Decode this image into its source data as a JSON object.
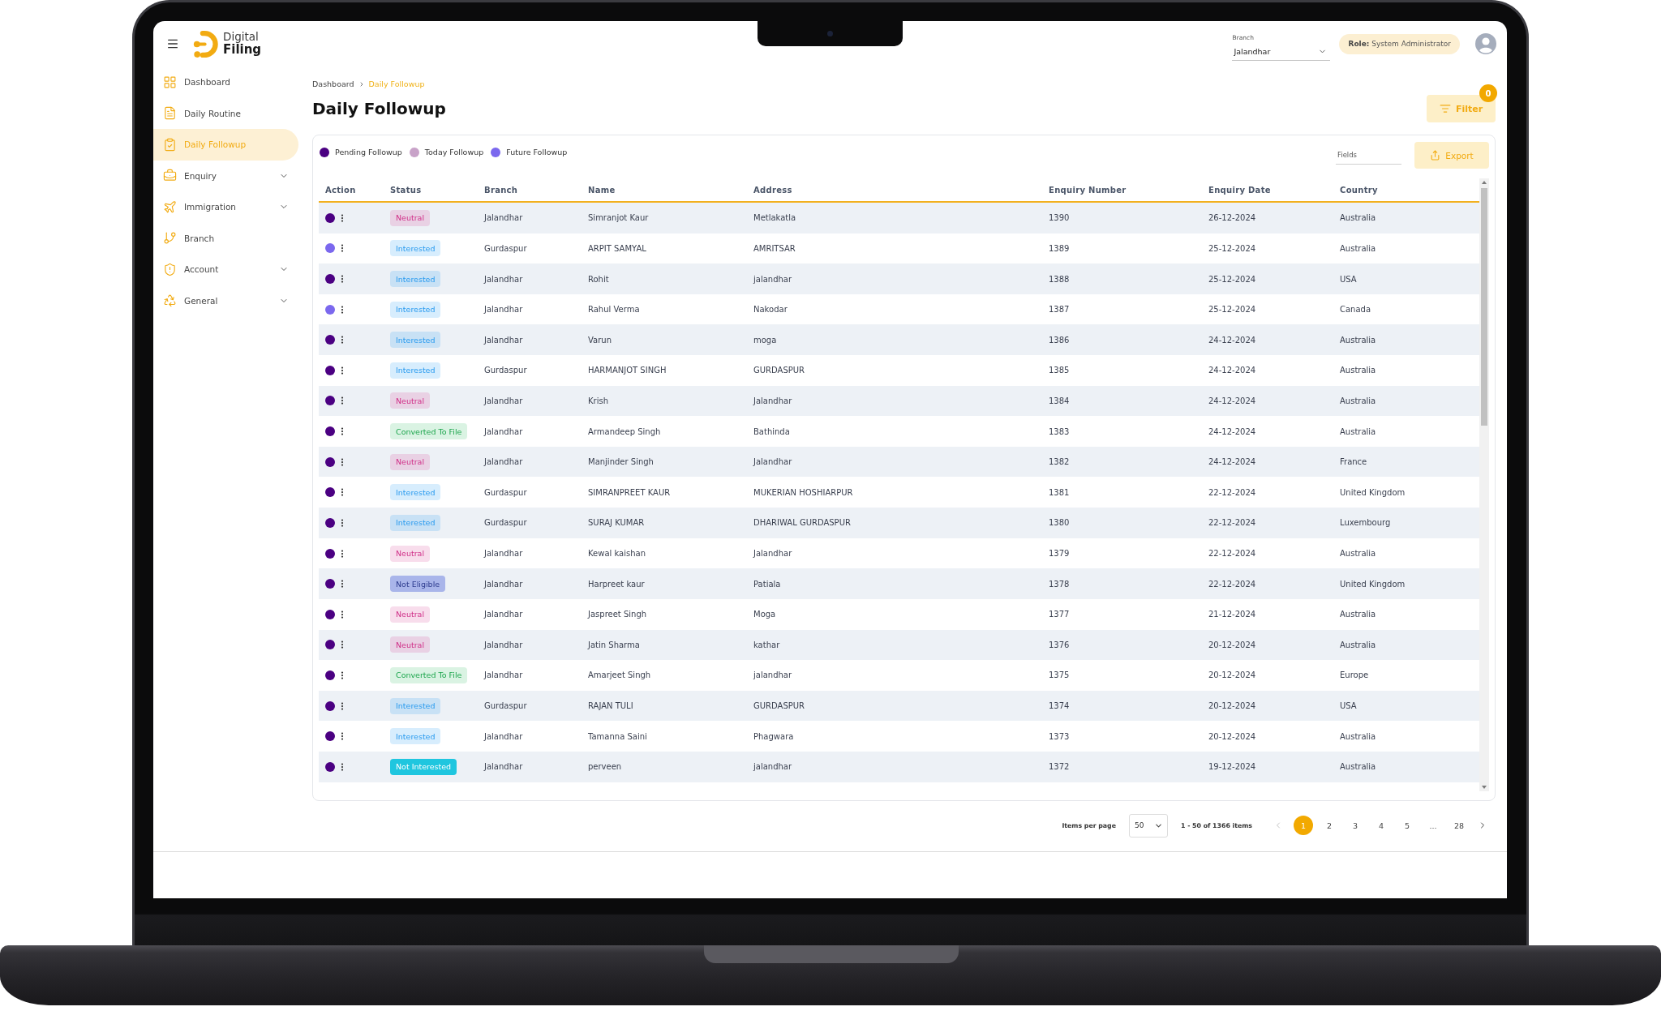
{
  "topbar": {
    "logo": {
      "line_1": "Digital",
      "line_2": "Filing"
    },
    "branch": {
      "label": "Branch",
      "value": "Jalandhar"
    },
    "role": "**Role:** System Administrator"
  },
  "sidebar": {
    "items": [
      {
        "label": "Dashboard",
        "selected": false,
        "expandable": false
      },
      {
        "label": "Daily Routine",
        "selected": false,
        "expandable": false
      },
      {
        "label": "Daily Followup",
        "selected": true,
        "expandable": false
      },
      {
        "label": "Enquiry",
        "selected": false,
        "expandable": true
      },
      {
        "label": "Immigration",
        "selected": false,
        "expandable": true
      },
      {
        "label": "Branch",
        "selected": false,
        "expandable": false
      },
      {
        "label": "Account",
        "selected": false,
        "expandable": true
      },
      {
        "label": "General",
        "selected": false,
        "expandable": true
      }
    ]
  },
  "breadcrumb": [
    {
      "label": "Dashboard",
      "selected": false
    },
    {
      "label": "Daily Followup",
      "selected": true
    }
  ],
  "page_title": "Daily Followup",
  "filter_button": {
    "label": "Filter",
    "count": "0"
  },
  "legend": [
    {
      "label": "Pending Followup",
      "color": "#4b0082"
    },
    {
      "label": "Today Followup",
      "color": "#c8a2c8"
    },
    {
      "label": "Future Followup",
      "color": "#7b68ee"
    }
  ],
  "fields_select": {
    "placeholder": "Fields"
  },
  "export_button": {
    "label": "Export"
  },
  "table": {
    "columns": [
      "Action",
      "Status",
      "Branch",
      "Name",
      "Address",
      "Enquiry Number",
      "Enquiry Date",
      "Country"
    ],
    "rows": [
      {
        "color": "#4b0082",
        "status": {
          "label": "Neutral",
          "kind": "neutral"
        },
        "branch": "Jalandhar",
        "name": "Simranjot Kaur",
        "address": "Metlakatla",
        "enquiry_number": "1390",
        "enquiry_date": "26-12-2024",
        "country": "Australia"
      },
      {
        "color": "#7b68ee",
        "status": {
          "label": "Interested",
          "kind": "interested"
        },
        "branch": "Gurdaspur",
        "name": "ARPIT SAMYAL",
        "address": "AMRITSAR",
        "enquiry_number": "1389",
        "enquiry_date": "25-12-2024",
        "country": "Australia"
      },
      {
        "color": "#4b0082",
        "status": {
          "label": "Interested",
          "kind": "interested"
        },
        "branch": "Jalandhar",
        "name": "Rohit",
        "address": "jalandhar",
        "enquiry_number": "1388",
        "enquiry_date": "25-12-2024",
        "country": "USA"
      },
      {
        "color": "#7b68ee",
        "status": {
          "label": "Interested",
          "kind": "interested"
        },
        "branch": "Jalandhar",
        "name": "Rahul Verma",
        "address": "Nakodar",
        "enquiry_number": "1387",
        "enquiry_date": "25-12-2024",
        "country": "Canada"
      },
      {
        "color": "#4b0082",
        "status": {
          "label": "Interested",
          "kind": "interested"
        },
        "branch": "Jalandhar",
        "name": "Varun",
        "address": "moga",
        "enquiry_number": "1386",
        "enquiry_date": "24-12-2024",
        "country": "Australia"
      },
      {
        "color": "#4b0082",
        "status": {
          "label": "Interested",
          "kind": "interested"
        },
        "branch": "Gurdaspur",
        "name": "HARMANJOT SINGH",
        "address": "GURDASPUR",
        "enquiry_number": "1385",
        "enquiry_date": "24-12-2024",
        "country": "Australia"
      },
      {
        "color": "#4b0082",
        "status": {
          "label": "Neutral",
          "kind": "neutral"
        },
        "branch": "Jalandhar",
        "name": "Krish",
        "address": "Jalandhar",
        "enquiry_number": "1384",
        "enquiry_date": "24-12-2024",
        "country": "Australia"
      },
      {
        "color": "#4b0082",
        "status": {
          "label": "Converted To File",
          "kind": "converted"
        },
        "branch": "Jalandhar",
        "name": "Armandeep Singh",
        "address": "Bathinda",
        "enquiry_number": "1383",
        "enquiry_date": "24-12-2024",
        "country": "Australia"
      },
      {
        "color": "#4b0082",
        "status": {
          "label": "Neutral",
          "kind": "neutral"
        },
        "branch": "Jalandhar",
        "name": "Manjinder Singh",
        "address": "Jalandhar",
        "enquiry_number": "1382",
        "enquiry_date": "24-12-2024",
        "country": "France"
      },
      {
        "color": "#4b0082",
        "status": {
          "label": "Interested",
          "kind": "interested"
        },
        "branch": "Gurdaspur",
        "name": "SIMRANPREET KAUR",
        "address": "MUKERIAN HOSHIARPUR",
        "enquiry_number": "1381",
        "enquiry_date": "22-12-2024",
        "country": "United Kingdom"
      },
      {
        "color": "#4b0082",
        "status": {
          "label": "Interested",
          "kind": "interested"
        },
        "branch": "Gurdaspur",
        "name": "SURAJ KUMAR",
        "address": "DHARIWAL GURDASPUR",
        "enquiry_number": "1380",
        "enquiry_date": "22-12-2024",
        "country": "Luxembourg"
      },
      {
        "color": "#4b0082",
        "status": {
          "label": "Neutral",
          "kind": "neutral"
        },
        "branch": "Jalandhar",
        "name": "Kewal kaishan",
        "address": "Jalandhar",
        "enquiry_number": "1379",
        "enquiry_date": "22-12-2024",
        "country": "Australia"
      },
      {
        "color": "#4b0082",
        "status": {
          "label": "Not Eligible",
          "kind": "not-eligible"
        },
        "branch": "Jalandhar",
        "name": "Harpreet kaur",
        "address": "Patiala",
        "enquiry_number": "1378",
        "enquiry_date": "22-12-2024",
        "country": "United Kingdom"
      },
      {
        "color": "#4b0082",
        "status": {
          "label": "Neutral",
          "kind": "neutral"
        },
        "branch": "Jalandhar",
        "name": "Jaspreet Singh",
        "address": "Moga",
        "enquiry_number": "1377",
        "enquiry_date": "21-12-2024",
        "country": "Australia"
      },
      {
        "color": "#4b0082",
        "status": {
          "label": "Neutral",
          "kind": "neutral"
        },
        "branch": "Jalandhar",
        "name": "Jatin Sharma",
        "address": "kathar",
        "enquiry_number": "1376",
        "enquiry_date": "20-12-2024",
        "country": "Australia"
      },
      {
        "color": "#4b0082",
        "status": {
          "label": "Converted To File",
          "kind": "converted"
        },
        "branch": "Jalandhar",
        "name": "Amarjeet Singh",
        "address": "jalandhar",
        "enquiry_number": "1375",
        "enquiry_date": "20-12-2024",
        "country": "Europe"
      },
      {
        "color": "#4b0082",
        "status": {
          "label": "Interested",
          "kind": "interested"
        },
        "branch": "Gurdaspur",
        "name": "RAJAN TULI",
        "address": "GURDASPUR",
        "enquiry_number": "1374",
        "enquiry_date": "20-12-2024",
        "country": "USA"
      },
      {
        "color": "#4b0082",
        "status": {
          "label": "Interested",
          "kind": "interested"
        },
        "branch": "Jalandhar",
        "name": "Tamanna Saini",
        "address": "Phagwara",
        "enquiry_number": "1373",
        "enquiry_date": "20-12-2024",
        "country": "Australia"
      },
      {
        "color": "#4b0082",
        "status": {
          "label": "Not Interested",
          "kind": "not-interested"
        },
        "branch": "Jalandhar",
        "name": "perveen",
        "address": "jalandhar",
        "enquiry_number": "1372",
        "enquiry_date": "19-12-2024",
        "country": "Australia"
      }
    ]
  },
  "pagination": {
    "items_per_page_label": "Items per page",
    "page_size": "50",
    "range": "1 - 50 of 1366 items",
    "previous": {
      "disabled": true
    },
    "pages": [
      {
        "label": "1",
        "kind": "page",
        "selected": true
      },
      {
        "label": "2",
        "kind": "page",
        "selected": false
      },
      {
        "label": "3",
        "kind": "page",
        "selected": false
      },
      {
        "label": "4",
        "kind": "page",
        "selected": false
      },
      {
        "label": "5",
        "kind": "page",
        "selected": false
      },
      {
        "label": "...",
        "kind": "gap",
        "selected": false
      },
      {
        "label": "28",
        "kind": "page",
        "selected": false
      }
    ],
    "next": {
      "disabled": false
    }
  }
}
